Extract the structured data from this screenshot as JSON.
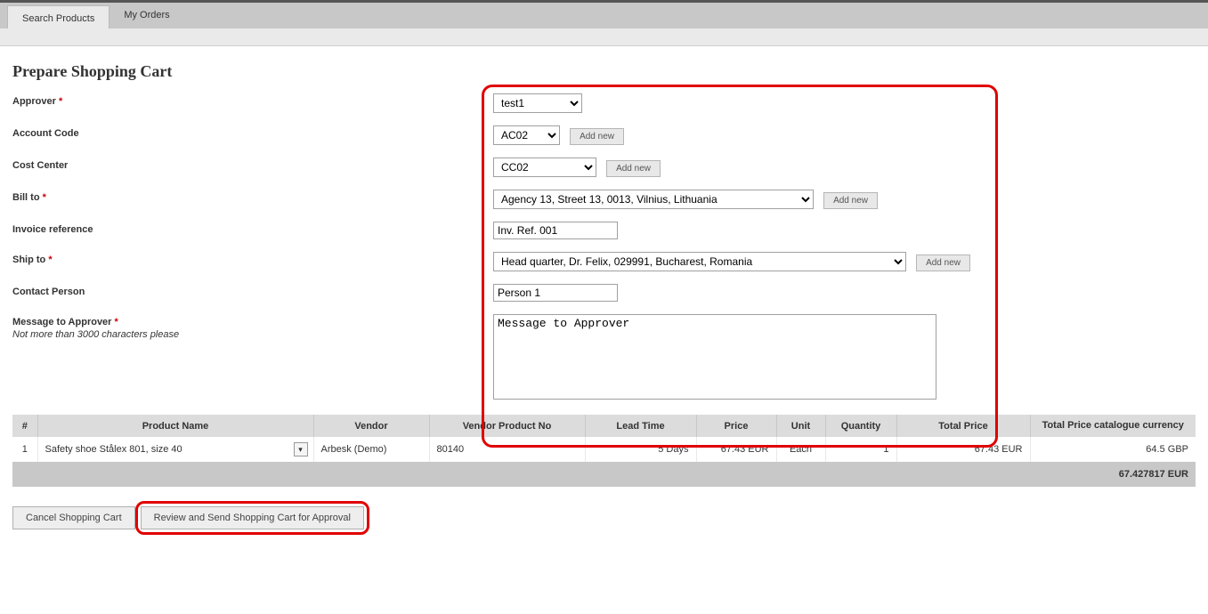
{
  "tabs": {
    "search": "Search Products",
    "orders": "My Orders"
  },
  "page_title": "Prepare Shopping Cart",
  "labels": {
    "approver": "Approver",
    "account_code": "Account Code",
    "cost_center": "Cost Center",
    "bill_to": "Bill to",
    "invoice_ref": "Invoice reference",
    "ship_to": "Ship to",
    "contact_person": "Contact Person",
    "message": "Message to Approver",
    "message_hint": "Not more than 3000 characters please"
  },
  "values": {
    "approver": "test1",
    "account_code": "AC02",
    "cost_center": "CC02",
    "bill_to": "Agency 13, Street 13, 0013, Vilnius, Lithuania",
    "invoice_ref": "Inv. Ref. 001",
    "ship_to": "Head quarter, Dr. Felix, 029991, Bucharest, Romania",
    "contact_person": "Person 1",
    "message": "Message to Approver"
  },
  "buttons": {
    "add_new": "Add new",
    "cancel": "Cancel Shopping Cart",
    "review": "Review and Send Shopping Cart for Approval"
  },
  "table": {
    "headers": {
      "num": "#",
      "product_name": "Product Name",
      "vendor": "Vendor",
      "vendor_prod_no": "Vendor Product No",
      "lead_time": "Lead Time",
      "price": "Price",
      "unit": "Unit",
      "quantity": "Quantity",
      "total_price": "Total Price",
      "total_price_cat": "Total Price catalogue currency"
    },
    "rows": [
      {
        "num": "1",
        "product_name": "Safety shoe Stålex 801, size 40",
        "vendor": "Arbesk (Demo)",
        "vendor_prod_no": "80140",
        "lead_time": "5 Days",
        "price": "67.43 EUR",
        "unit": "Each",
        "quantity": "1",
        "total_price": "67.43 EUR",
        "total_price_cat": "64.5 GBP"
      }
    ],
    "grand_total": "67.427817 EUR"
  }
}
